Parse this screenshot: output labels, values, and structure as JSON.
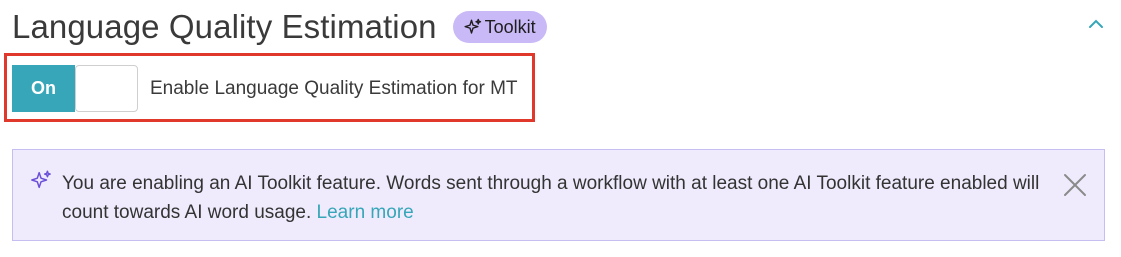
{
  "header": {
    "title": "Language Quality Estimation",
    "badge_label": "Toolkit"
  },
  "toggle": {
    "state_label": "On",
    "description": "Enable Language Quality Estimation for MT"
  },
  "banner": {
    "message": "You are enabling an AI Toolkit feature. Words sent through a workflow with at least one AI Toolkit feature enabled will count towards AI word usage.",
    "link_label": "Learn more"
  },
  "colors": {
    "accent": "#36a6b8",
    "badge_bg": "#c9b9f7",
    "banner_bg": "#efebfd",
    "highlight": "#e0392b",
    "sparkle": "#6b4fd8"
  },
  "icons": {
    "badge": "sparkle-icon",
    "collapse": "chevron-up-icon",
    "banner": "sparkle-icon",
    "close": "close-icon"
  }
}
